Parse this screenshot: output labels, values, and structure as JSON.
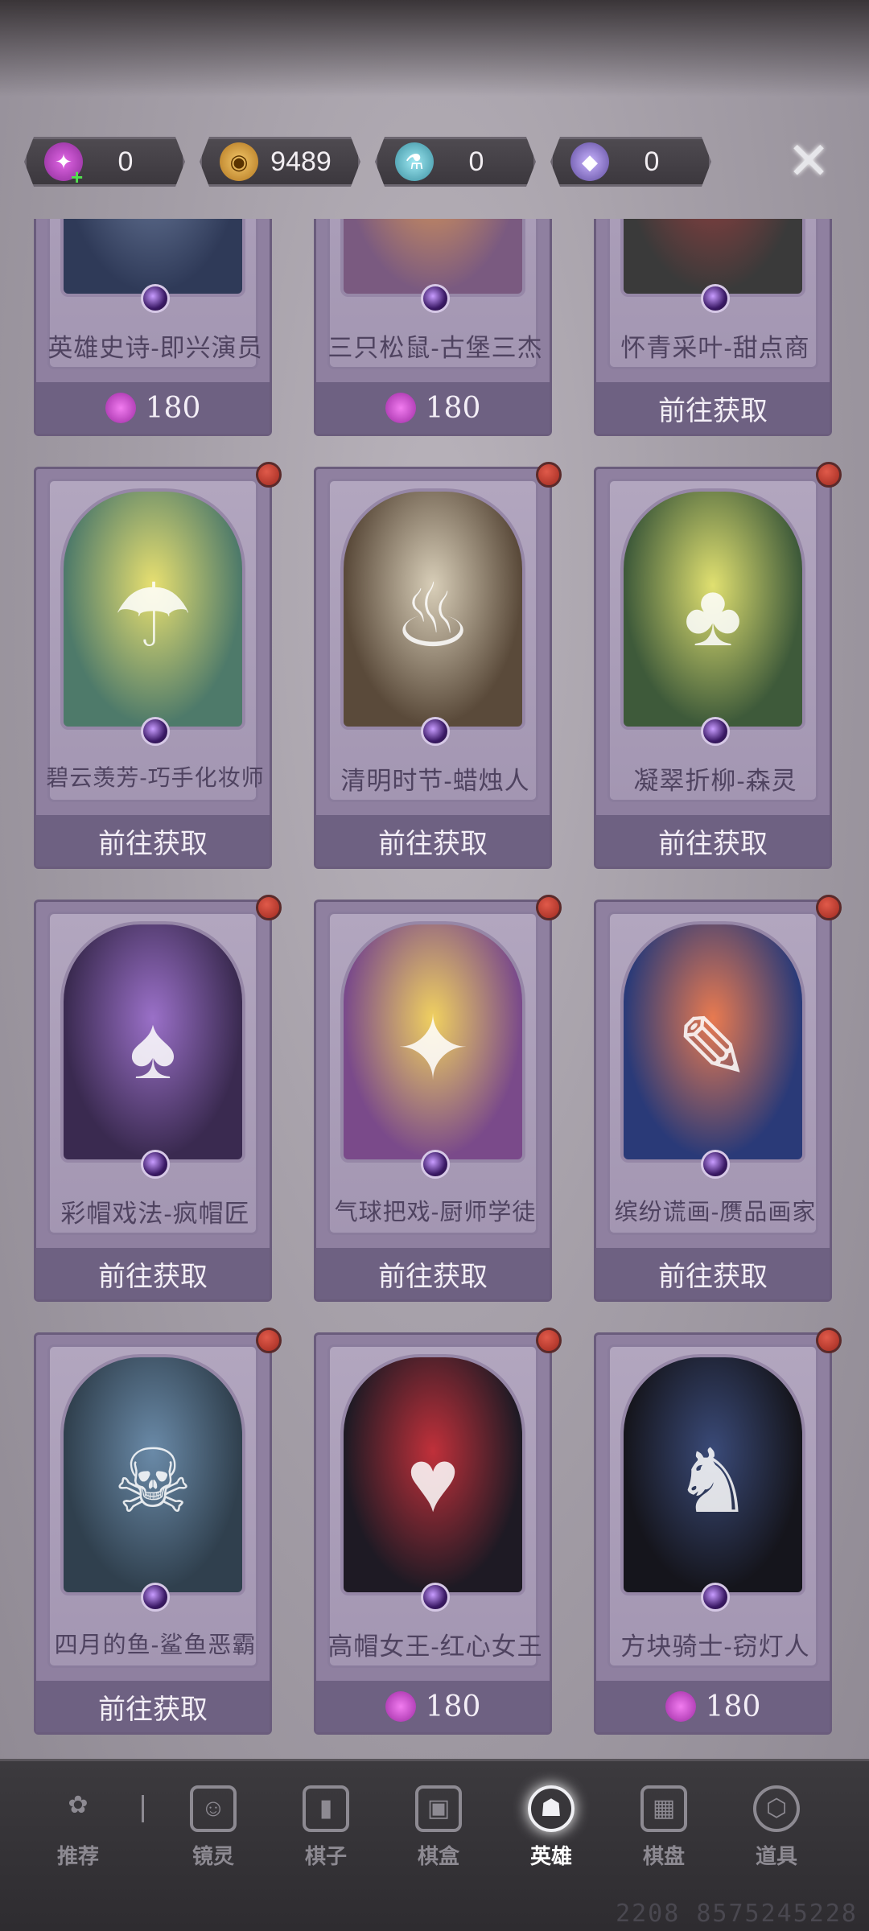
{
  "currencies": [
    {
      "icon": "candy-add-icon",
      "value": "0"
    },
    {
      "icon": "pumpkin-coin-icon",
      "value": "9489"
    },
    {
      "icon": "potion-icon",
      "value": "0"
    },
    {
      "icon": "gem-icon",
      "value": "0"
    }
  ],
  "close_label": "✕",
  "cards": [
    {
      "name": "英雄史诗-即兴演员",
      "action": "",
      "price": "180"
    },
    {
      "name": "三只松鼠-古堡三杰",
      "action": "",
      "price": "180"
    },
    {
      "name": "怀青采叶-甜点商",
      "action": "前往获取",
      "price": ""
    },
    {
      "name": "碧云羡芳-巧手化妆师",
      "action": "前往获取",
      "price": ""
    },
    {
      "name": "清明时节-蜡烛人",
      "action": "前往获取",
      "price": ""
    },
    {
      "name": "凝翠折柳-森灵",
      "action": "前往获取",
      "price": ""
    },
    {
      "name": "彩帽戏法-疯帽匠",
      "action": "前往获取",
      "price": ""
    },
    {
      "name": "气球把戏-厨师学徒",
      "action": "前往获取",
      "price": ""
    },
    {
      "name": "缤纷谎画-赝品画家",
      "action": "前往获取",
      "price": ""
    },
    {
      "name": "四月的鱼-鲨鱼恶霸",
      "action": "前往获取",
      "price": ""
    },
    {
      "name": "高帽女王-红心女王",
      "action": "",
      "price": "180"
    },
    {
      "name": "方块骑士-窃灯人",
      "action": "",
      "price": "180"
    }
  ],
  "nav": [
    {
      "label": "推荐",
      "icon": "recommend-icon"
    },
    {
      "label": "镜灵",
      "icon": "mirror-spirit-icon"
    },
    {
      "label": "棋子",
      "icon": "chess-piece-icon"
    },
    {
      "label": "棋盒",
      "icon": "chess-box-icon"
    },
    {
      "label": "英雄",
      "icon": "hero-icon"
    },
    {
      "label": "棋盘",
      "icon": "chessboard-icon"
    },
    {
      "label": "道具",
      "icon": "props-icon"
    }
  ],
  "watermark": "2208 8575245228"
}
